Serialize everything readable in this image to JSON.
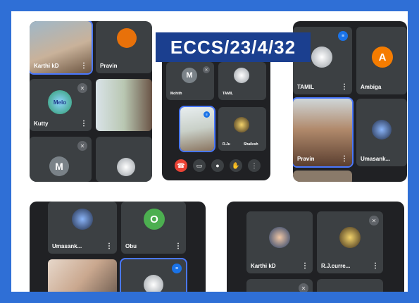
{
  "banner": {
    "text": "ECCS/23/4/32"
  },
  "participants": {
    "karthi_kd": "Karthi kD",
    "pravin": "Pravin",
    "kutty": "Kutty",
    "tamil": "TAMIL",
    "ambiga": "Ambiga",
    "umasank": "Umasank...",
    "obu": "Obu",
    "rj_curre": "R.J.curre...",
    "mohith": "Mohith",
    "r_ju": "R.Ju",
    "shailesh": "Shailesh"
  },
  "avatars": {
    "m_letter": "M",
    "a_letter": "A",
    "o_letter": "O",
    "melo_text": "Melo"
  },
  "colors": {
    "frame_blue": "#2f6fd6",
    "banner_navy": "#1b3f8f",
    "meet_bg": "#202124",
    "tile_bg": "#3c4043",
    "end_call_red": "#ea4335",
    "speaking_blue": "#1a73e8",
    "ambiga_orange": "#f57c00",
    "obu_green": "#4caf50"
  },
  "icons": [
    "mic-off-icon",
    "speaking-icon",
    "more-vert-icon",
    "end-call-icon",
    "camera-icon",
    "mic-icon",
    "hand-icon",
    "more-options-icon"
  ]
}
